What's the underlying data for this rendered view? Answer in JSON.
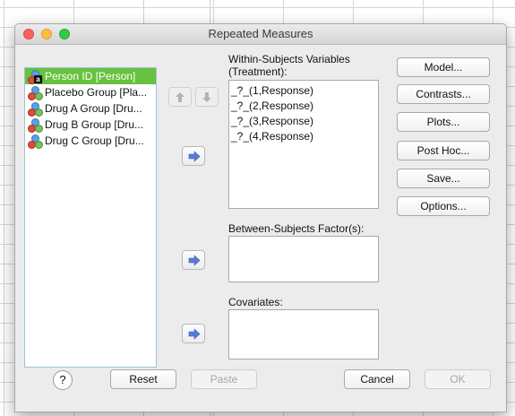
{
  "window": {
    "title": "Repeated Measures"
  },
  "variables": [
    {
      "label": "Person ID [Person]",
      "icon": "nominal-variable-icon",
      "selected": true
    },
    {
      "label": "Placebo Group [Pla...",
      "icon": "scale-variable-icon",
      "selected": false
    },
    {
      "label": "Drug A Group [Dru...",
      "icon": "scale-variable-icon",
      "selected": false
    },
    {
      "label": "Drug B Group [Dru...",
      "icon": "scale-variable-icon",
      "selected": false
    },
    {
      "label": "Drug C Group [Dru...",
      "icon": "scale-variable-icon",
      "selected": false
    }
  ],
  "within": {
    "label_line1": "Within-Subjects Variables",
    "label_line2": "(Treatment):",
    "items": [
      "_?_(1,Response)",
      "_?_(2,Response)",
      "_?_(3,Response)",
      "_?_(4,Response)"
    ]
  },
  "between": {
    "label": "Between-Subjects Factor(s):"
  },
  "covariates": {
    "label": "Covariates:"
  },
  "side_buttons": {
    "model": "Model...",
    "contrasts": "Contrasts...",
    "plots": "Plots...",
    "post_hoc": "Post Hoc...",
    "save": "Save...",
    "options": "Options..."
  },
  "footer": {
    "help": "?",
    "reset": "Reset",
    "paste": "Paste",
    "cancel": "Cancel",
    "ok": "OK"
  },
  "colors": {
    "selection": "#68c13f",
    "arrow": "#5b7ad8"
  }
}
